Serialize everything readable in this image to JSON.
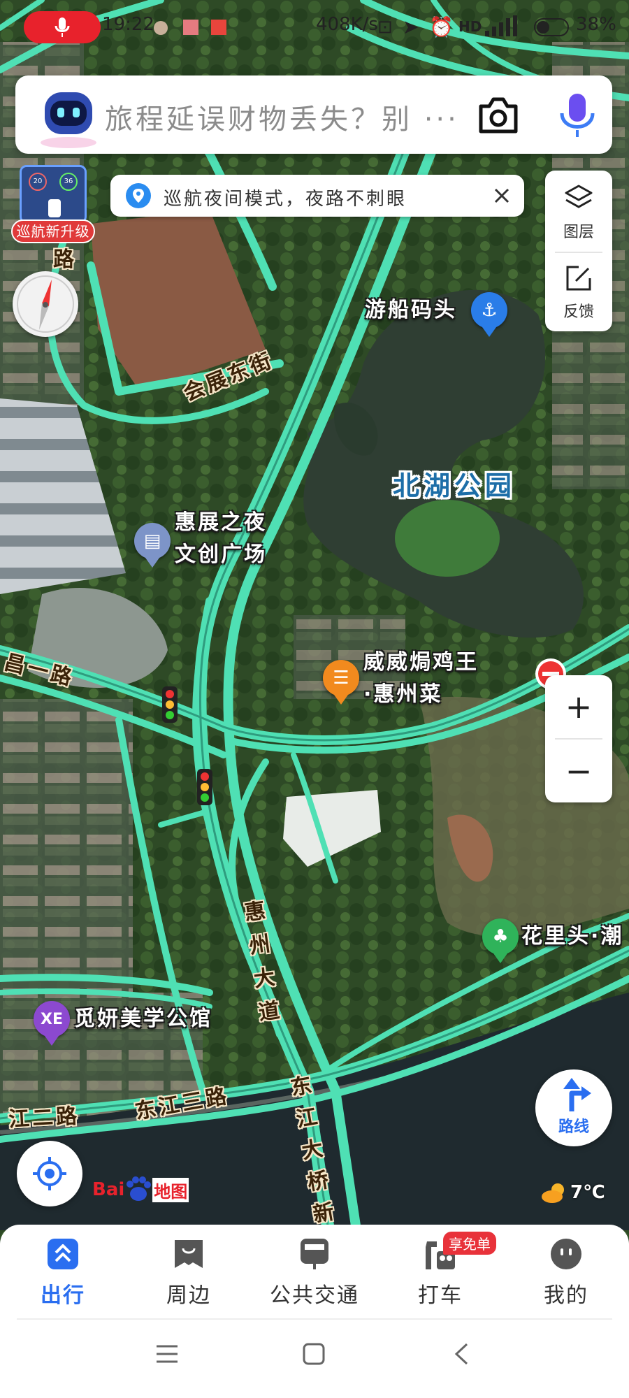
{
  "status_bar": {
    "time": "19:22",
    "net_speed": "408K/s",
    "battery": "38%"
  },
  "search": {
    "placeholder": "旅程延误财物丢失？别 ···"
  },
  "tip": {
    "text": "巡航夜间模式，夜路不刺眼"
  },
  "cruise_badge": {
    "label": "巡航新升级",
    "speed_left": "20",
    "speed_right": "36"
  },
  "right_panel": {
    "layers_label": "图层",
    "feedback_label": "反馈"
  },
  "zoom": {
    "in": "+",
    "out": "−"
  },
  "route_button": {
    "label": "路线"
  },
  "weather": {
    "temp": "7℃"
  },
  "logo": {
    "text_left": "Bai",
    "text_right": "地图"
  },
  "map": {
    "road_labels": {
      "r1": "会展东街",
      "r2": "昌一路",
      "r3": "惠州大道",
      "r4": "东江大桥新",
      "r5": "江二路",
      "r6": "东江三路",
      "r7": "路"
    },
    "pois": {
      "pier": "游船码头",
      "park": "北湖公园",
      "plaza_1": "惠展之夜",
      "plaza_2": "文创广场",
      "restaurant_1": "威威焗鸡王",
      "restaurant_2": "·惠州菜",
      "flower": "花里头·潮",
      "beauty": "觅妍美学公馆"
    },
    "beauty_pin": "XE"
  },
  "bottom_nav": {
    "tabs": [
      {
        "label": "出行",
        "active": true
      },
      {
        "label": "周边",
        "active": false
      },
      {
        "label": "公共交通",
        "active": false
      },
      {
        "label": "打车",
        "active": false
      },
      {
        "label": "我的",
        "active": false
      }
    ],
    "taxi_badge": "享免单"
  },
  "colors": {
    "road": "#4fe0b4",
    "accent_blue": "#2a6ef0",
    "red": "#e8222c"
  }
}
